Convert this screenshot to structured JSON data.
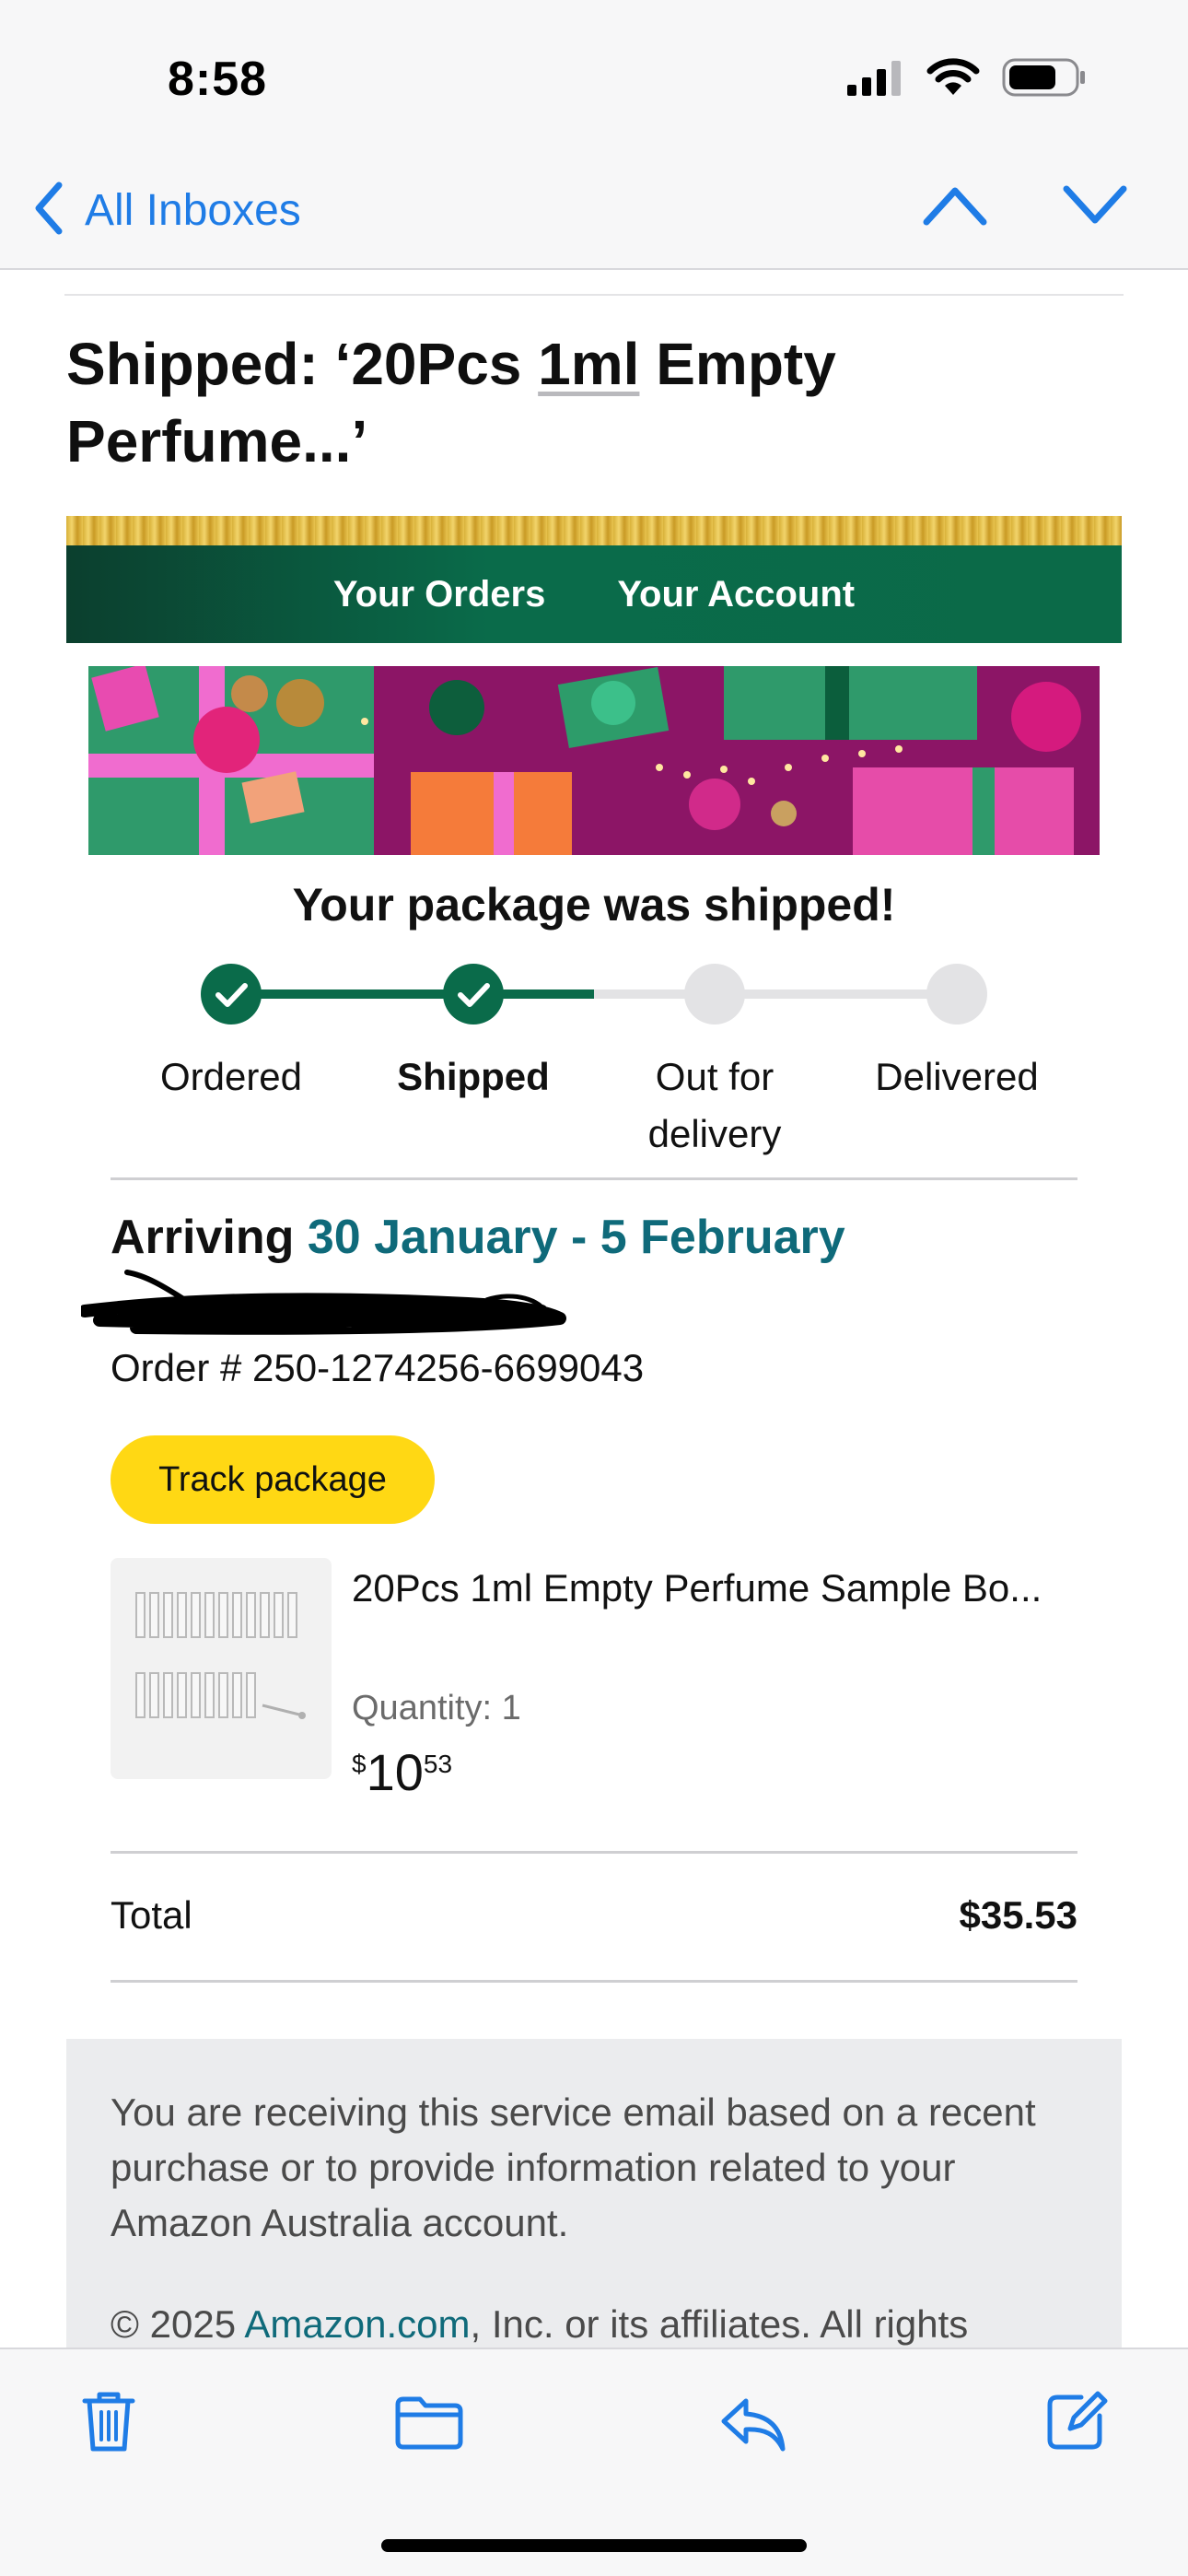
{
  "status_bar": {
    "time": "8:58",
    "icons": [
      "cellular-signal-icon",
      "wifi-icon",
      "battery-icon"
    ]
  },
  "nav": {
    "back_label": "All Inboxes",
    "icons": [
      "chevron-left-icon",
      "chevron-up-icon",
      "chevron-down-icon"
    ]
  },
  "email": {
    "subject_part1": "Shipped: ‘20Pcs ",
    "subject_underlined": "1ml",
    "subject_part2": " Empty Perfume...’",
    "header_links": [
      "Your Orders",
      "Your Account"
    ],
    "shipped_title": "Your package was shipped!",
    "steps": [
      {
        "label": "Ordered",
        "status": "done"
      },
      {
        "label": "Shipped",
        "status": "done",
        "current": true
      },
      {
        "label": "Out for delivery",
        "status": "pending"
      },
      {
        "label": "Delivered",
        "status": "pending"
      }
    ],
    "arriving_label": "Arriving",
    "arriving_dates": "30 January - 5 February",
    "order_number": "Order # 250-1274256-6699043",
    "track_button": "Track package",
    "product": {
      "name": "20Pcs 1ml Empty Perfume Sample Bo...",
      "quantity": "Quantity: 1",
      "price_symbol": "$",
      "price_whole": "10",
      "price_fraction": "53"
    },
    "total_label": "Total",
    "total_value": "$35.53",
    "footer_text": "You are receiving this service email based on a recent purchase or to provide information related to your Amazon Australia account.",
    "footer_copy_prefix": "© 2025 ",
    "footer_copy_link": "Amazon.com",
    "footer_copy_suffix": ", Inc. or its affiliates. All rights"
  },
  "toolbar": {
    "icons": [
      "trash-icon",
      "folder-icon",
      "reply-icon",
      "compose-icon"
    ]
  },
  "colors": {
    "ios_blue": "#1f7ce6",
    "amazon_green": "#0a6b4a",
    "teal_link": "#0f6a7a",
    "track_yellow": "#ffd814"
  }
}
